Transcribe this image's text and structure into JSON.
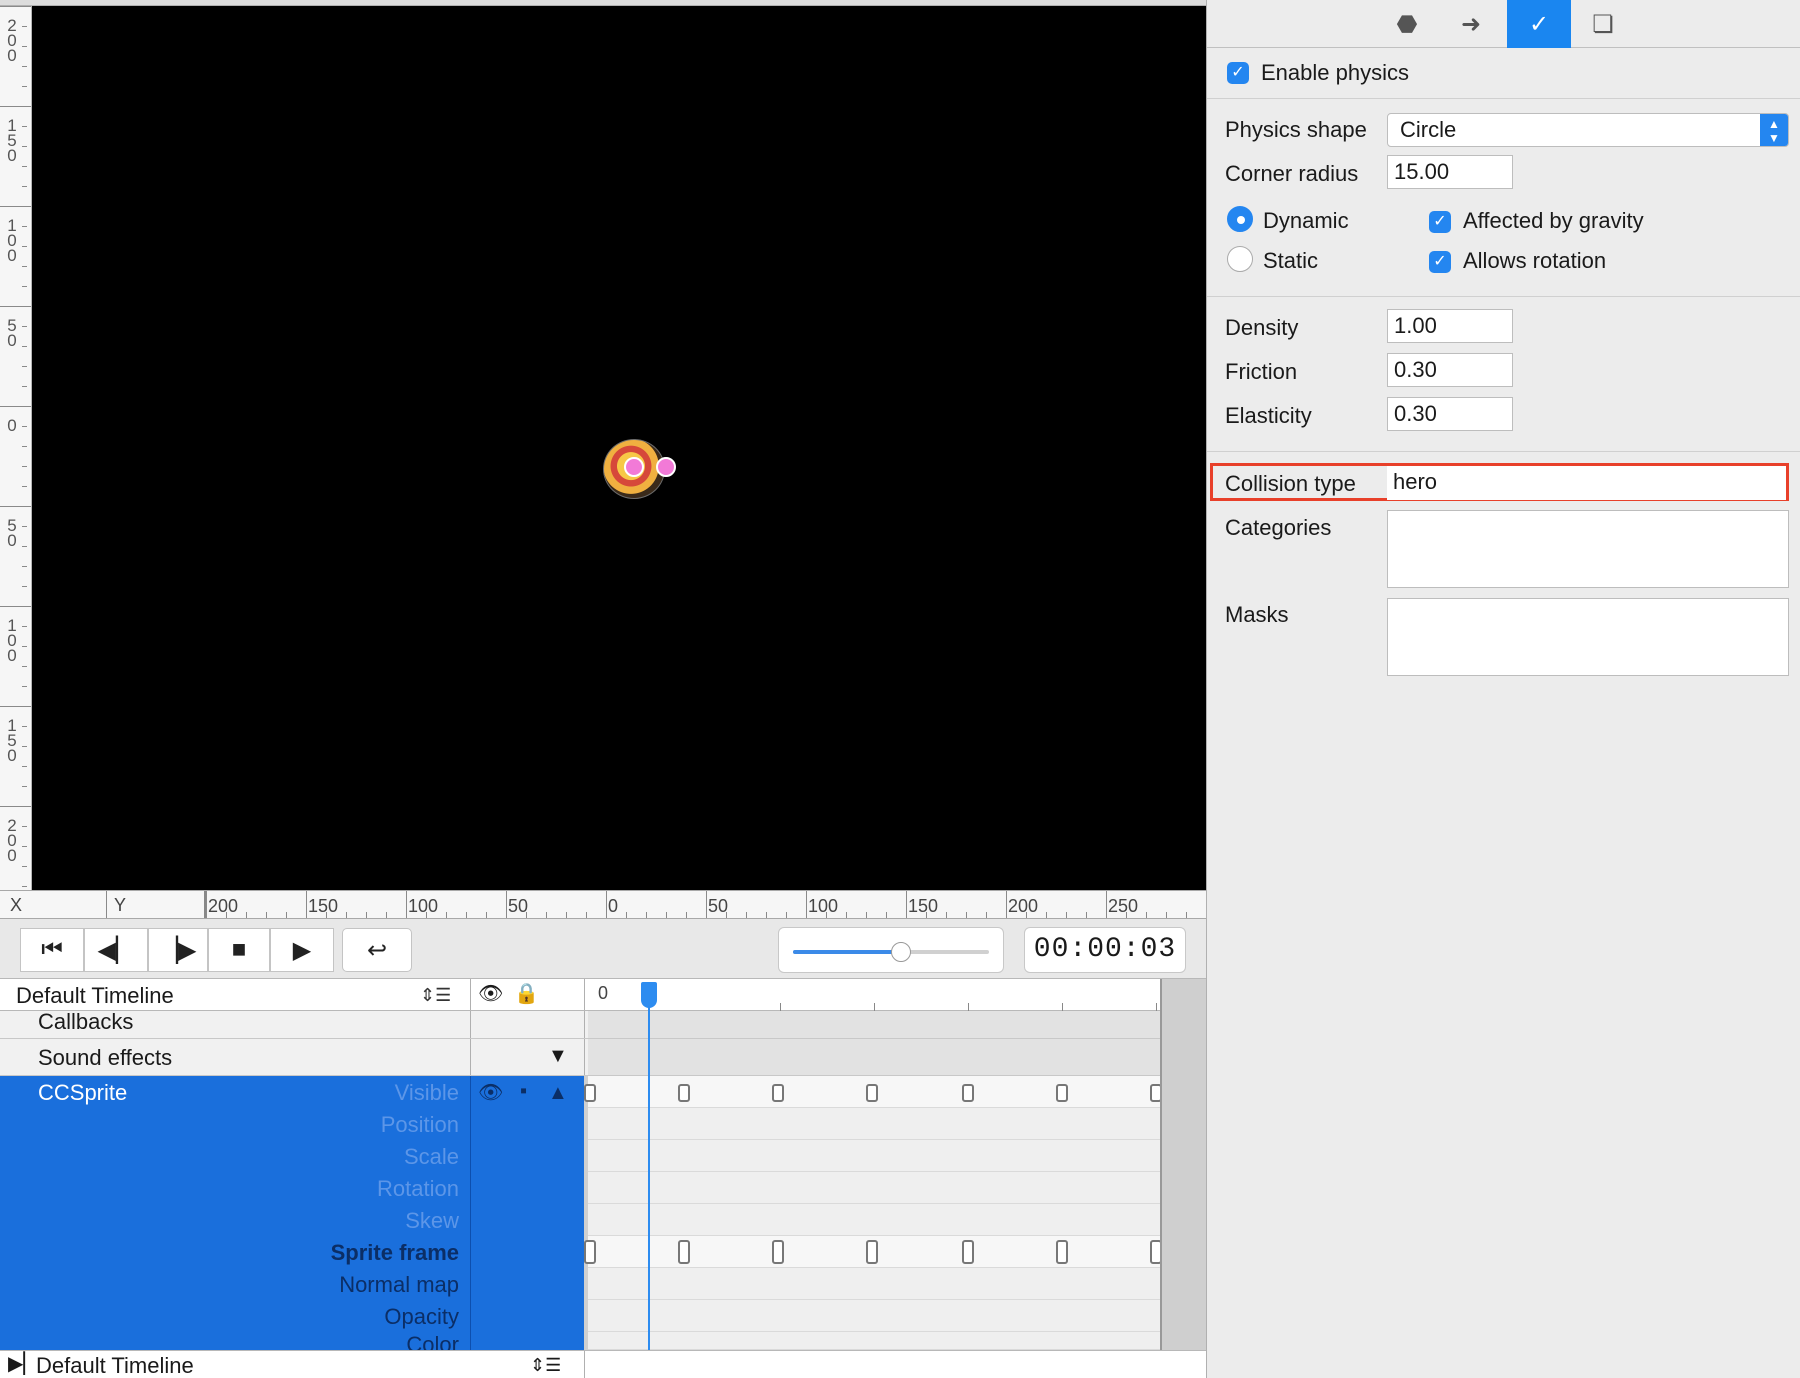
{
  "ruler_vertical": {
    "labels": [
      "200",
      "150",
      "100",
      "50",
      "0",
      "50",
      "100",
      "150",
      "200"
    ]
  },
  "ruler_horizontal": {
    "x_label": "X",
    "y_label": "Y",
    "labels": [
      "200",
      "150",
      "100",
      "50",
      "0",
      "50",
      "100",
      "150",
      "200",
      "250"
    ]
  },
  "transport": {
    "buttons": [
      "skip-to-start-icon",
      "step-back-icon",
      "step-forward-icon",
      "stop-icon",
      "play-icon",
      "loop-icon"
    ],
    "slider_value": 0.55,
    "time": "00:00:03"
  },
  "timeline": {
    "name": "Default Timeline",
    "ruler_start": "0",
    "ruler_end": "1",
    "rows": {
      "callbacks": "Callbacks",
      "sound_effects": "Sound effects"
    },
    "node_name": "CCSprite",
    "properties": [
      "Visible",
      "Position",
      "Scale",
      "Rotation",
      "Skew",
      "Sprite frame",
      "Normal map",
      "Opacity",
      "Color"
    ],
    "footer_name": "Default Timeline"
  },
  "inspector": {
    "tabs": [
      "node-properties-icon",
      "code-connections-icon",
      "physics-icon",
      "templates-icon"
    ],
    "enable_physics": "Enable physics",
    "physics_shape_label": "Physics shape",
    "physics_shape_value": "Circle",
    "corner_radius_label": "Corner radius",
    "corner_radius_value": "15.00",
    "dynamic_label": "Dynamic",
    "static_label": "Static",
    "gravity_label": "Affected by gravity",
    "rotation_label": "Allows rotation",
    "density_label": "Density",
    "density_value": "1.00",
    "friction_label": "Friction",
    "friction_value": "0.30",
    "elasticity_label": "Elasticity",
    "elasticity_value": "0.30",
    "collision_type_label": "Collision type",
    "collision_type_value": "hero",
    "categories_label": "Categories",
    "masks_label": "Masks"
  },
  "colors": {
    "accent": "#1a86f0",
    "selection": "#1a6fdc",
    "highlight": "#e8402a",
    "canvas": "#000000"
  }
}
